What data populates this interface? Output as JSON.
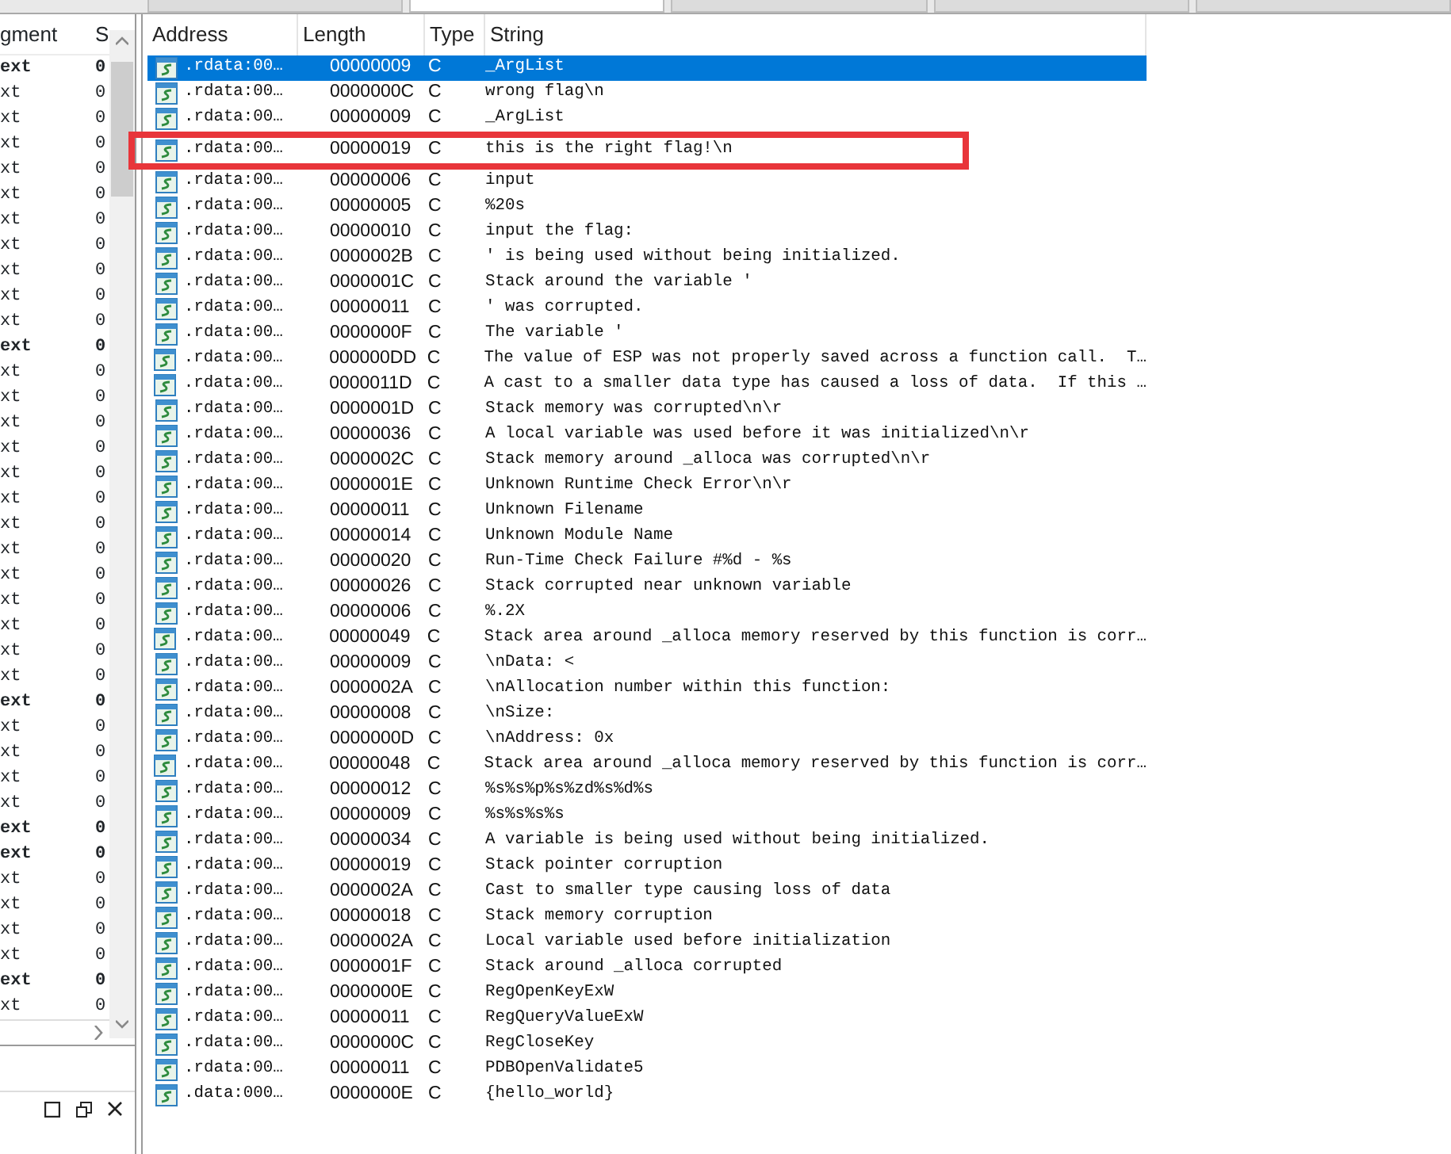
{
  "tabs": [
    {
      "selected": false
    },
    {
      "selected": true
    },
    {
      "selected": false
    },
    {
      "selected": false
    },
    {
      "selected": false
    }
  ],
  "segments_panel": {
    "columns": [
      "gment",
      "S"
    ],
    "rows": [
      {
        "segment": "ext",
        "start": "0",
        "bold": true
      },
      {
        "segment": "xt",
        "start": "0",
        "bold": false
      },
      {
        "segment": "xt",
        "start": "0",
        "bold": false
      },
      {
        "segment": "xt",
        "start": "0",
        "bold": false
      },
      {
        "segment": "xt",
        "start": "0",
        "bold": false
      },
      {
        "segment": "xt",
        "start": "0",
        "bold": false
      },
      {
        "segment": "xt",
        "start": "0",
        "bold": false
      },
      {
        "segment": "xt",
        "start": "0",
        "bold": false
      },
      {
        "segment": "xt",
        "start": "0",
        "bold": false
      },
      {
        "segment": "xt",
        "start": "0",
        "bold": false
      },
      {
        "segment": "xt",
        "start": "0",
        "bold": false
      },
      {
        "segment": "ext",
        "start": "0",
        "bold": true
      },
      {
        "segment": "xt",
        "start": "0",
        "bold": false
      },
      {
        "segment": "xt",
        "start": "0",
        "bold": false
      },
      {
        "segment": "xt",
        "start": "0",
        "bold": false
      },
      {
        "segment": "xt",
        "start": "0",
        "bold": false
      },
      {
        "segment": "xt",
        "start": "0",
        "bold": false
      },
      {
        "segment": "xt",
        "start": "0",
        "bold": false
      },
      {
        "segment": "xt",
        "start": "0",
        "bold": false
      },
      {
        "segment": "xt",
        "start": "0",
        "bold": false
      },
      {
        "segment": "xt",
        "start": "0",
        "bold": false
      },
      {
        "segment": "xt",
        "start": "0",
        "bold": false
      },
      {
        "segment": "xt",
        "start": "0",
        "bold": false
      },
      {
        "segment": "xt",
        "start": "0",
        "bold": false
      },
      {
        "segment": "xt",
        "start": "0",
        "bold": false
      },
      {
        "segment": "ext",
        "start": "0",
        "bold": true
      },
      {
        "segment": "xt",
        "start": "0",
        "bold": false
      },
      {
        "segment": "xt",
        "start": "0",
        "bold": false
      },
      {
        "segment": "xt",
        "start": "0",
        "bold": false
      },
      {
        "segment": "xt",
        "start": "0",
        "bold": false
      },
      {
        "segment": "ext",
        "start": "0",
        "bold": true
      },
      {
        "segment": "ext",
        "start": "0",
        "bold": true
      },
      {
        "segment": "xt",
        "start": "0",
        "bold": false
      },
      {
        "segment": "xt",
        "start": "0",
        "bold": false
      },
      {
        "segment": "xt",
        "start": "0",
        "bold": false
      },
      {
        "segment": "xt",
        "start": "0",
        "bold": false
      },
      {
        "segment": "ext",
        "start": "0",
        "bold": true
      },
      {
        "segment": "xt",
        "start": "0",
        "bold": false
      }
    ]
  },
  "strings_table": {
    "columns": [
      "Address",
      "Length",
      "Type",
      "String"
    ],
    "rows": [
      {
        "address": ".rdata:00…",
        "length": "00000009",
        "type": "C",
        "string": "_ArgList",
        "selected": true,
        "highlighted": false
      },
      {
        "address": ".rdata:00…",
        "length": "0000000C",
        "type": "C",
        "string": "wrong flag\\n",
        "selected": false,
        "highlighted": false
      },
      {
        "address": ".rdata:00…",
        "length": "00000009",
        "type": "C",
        "string": "_ArgList",
        "selected": false,
        "highlighted": false
      },
      {
        "address": ".rdata:00…",
        "length": "00000019",
        "type": "C",
        "string": "this is the right flag!\\n",
        "selected": false,
        "highlighted": true
      },
      {
        "address": ".rdata:00…",
        "length": "00000006",
        "type": "C",
        "string": "input",
        "selected": false,
        "highlighted": false
      },
      {
        "address": ".rdata:00…",
        "length": "00000005",
        "type": "C",
        "string": "%20s",
        "selected": false,
        "highlighted": false
      },
      {
        "address": ".rdata:00…",
        "length": "00000010",
        "type": "C",
        "string": "input the flag:",
        "selected": false,
        "highlighted": false
      },
      {
        "address": ".rdata:00…",
        "length": "0000002B",
        "type": "C",
        "string": "' is being used without being initialized.",
        "selected": false,
        "highlighted": false
      },
      {
        "address": ".rdata:00…",
        "length": "0000001C",
        "type": "C",
        "string": "Stack around the variable '",
        "selected": false,
        "highlighted": false
      },
      {
        "address": ".rdata:00…",
        "length": "00000011",
        "type": "C",
        "string": "' was corrupted.",
        "selected": false,
        "highlighted": false
      },
      {
        "address": ".rdata:00…",
        "length": "0000000F",
        "type": "C",
        "string": "The variable '",
        "selected": false,
        "highlighted": false
      },
      {
        "address": ".rdata:00…",
        "length": "000000DD",
        "type": "C",
        "string": "The value of ESP was not properly saved across a function call.  T…",
        "selected": false,
        "highlighted": false
      },
      {
        "address": ".rdata:00…",
        "length": "0000011D",
        "type": "C",
        "string": "A cast to a smaller data type has caused a loss of data.  If this …",
        "selected": false,
        "highlighted": false
      },
      {
        "address": ".rdata:00…",
        "length": "0000001D",
        "type": "C",
        "string": "Stack memory was corrupted\\n\\r",
        "selected": false,
        "highlighted": false
      },
      {
        "address": ".rdata:00…",
        "length": "00000036",
        "type": "C",
        "string": "A local variable was used before it was initialized\\n\\r",
        "selected": false,
        "highlighted": false
      },
      {
        "address": ".rdata:00…",
        "length": "0000002C",
        "type": "C",
        "string": "Stack memory around _alloca was corrupted\\n\\r",
        "selected": false,
        "highlighted": false
      },
      {
        "address": ".rdata:00…",
        "length": "0000001E",
        "type": "C",
        "string": "Unknown Runtime Check Error\\n\\r",
        "selected": false,
        "highlighted": false
      },
      {
        "address": ".rdata:00…",
        "length": "00000011",
        "type": "C",
        "string": "Unknown Filename",
        "selected": false,
        "highlighted": false
      },
      {
        "address": ".rdata:00…",
        "length": "00000014",
        "type": "C",
        "string": "Unknown Module Name",
        "selected": false,
        "highlighted": false
      },
      {
        "address": ".rdata:00…",
        "length": "00000020",
        "type": "C",
        "string": "Run-Time Check Failure #%d - %s",
        "selected": false,
        "highlighted": false
      },
      {
        "address": ".rdata:00…",
        "length": "00000026",
        "type": "C",
        "string": "Stack corrupted near unknown variable",
        "selected": false,
        "highlighted": false
      },
      {
        "address": ".rdata:00…",
        "length": "00000006",
        "type": "C",
        "string": "%.2X",
        "selected": false,
        "highlighted": false
      },
      {
        "address": ".rdata:00…",
        "length": "00000049",
        "type": "C",
        "string": "Stack area around _alloca memory reserved by this function is corr…",
        "selected": false,
        "highlighted": false
      },
      {
        "address": ".rdata:00…",
        "length": "00000009",
        "type": "C",
        "string": "\\nData: <",
        "selected": false,
        "highlighted": false
      },
      {
        "address": ".rdata:00…",
        "length": "0000002A",
        "type": "C",
        "string": "\\nAllocation number within this function:",
        "selected": false,
        "highlighted": false
      },
      {
        "address": ".rdata:00…",
        "length": "00000008",
        "type": "C",
        "string": "\\nSize:",
        "selected": false,
        "highlighted": false
      },
      {
        "address": ".rdata:00…",
        "length": "0000000D",
        "type": "C",
        "string": "\\nAddress: 0x",
        "selected": false,
        "highlighted": false
      },
      {
        "address": ".rdata:00…",
        "length": "00000048",
        "type": "C",
        "string": "Stack area around _alloca memory reserved by this function is corr…",
        "selected": false,
        "highlighted": false
      },
      {
        "address": ".rdata:00…",
        "length": "00000012",
        "type": "C",
        "string": "%s%s%p%s%zd%s%d%s",
        "selected": false,
        "highlighted": false
      },
      {
        "address": ".rdata:00…",
        "length": "00000009",
        "type": "C",
        "string": "%s%s%s%s",
        "selected": false,
        "highlighted": false
      },
      {
        "address": ".rdata:00…",
        "length": "00000034",
        "type": "C",
        "string": "A variable is being used without being initialized.",
        "selected": false,
        "highlighted": false
      },
      {
        "address": ".rdata:00…",
        "length": "00000019",
        "type": "C",
        "string": "Stack pointer corruption",
        "selected": false,
        "highlighted": false
      },
      {
        "address": ".rdata:00…",
        "length": "0000002A",
        "type": "C",
        "string": "Cast to smaller type causing loss of data",
        "selected": false,
        "highlighted": false
      },
      {
        "address": ".rdata:00…",
        "length": "00000018",
        "type": "C",
        "string": "Stack memory corruption",
        "selected": false,
        "highlighted": false
      },
      {
        "address": ".rdata:00…",
        "length": "0000002A",
        "type": "C",
        "string": "Local variable used before initialization",
        "selected": false,
        "highlighted": false
      },
      {
        "address": ".rdata:00…",
        "length": "0000001F",
        "type": "C",
        "string": "Stack around _alloca corrupted",
        "selected": false,
        "highlighted": false
      },
      {
        "address": ".rdata:00…",
        "length": "0000000E",
        "type": "C",
        "string": "RegOpenKeyExW",
        "selected": false,
        "highlighted": false
      },
      {
        "address": ".rdata:00…",
        "length": "00000011",
        "type": "C",
        "string": "RegQueryValueExW",
        "selected": false,
        "highlighted": false
      },
      {
        "address": ".rdata:00…",
        "length": "0000000C",
        "type": "C",
        "string": "RegCloseKey",
        "selected": false,
        "highlighted": false
      },
      {
        "address": ".rdata:00…",
        "length": "00000011",
        "type": "C",
        "string": "PDBOpenValidate5",
        "selected": false,
        "highlighted": false
      },
      {
        "address": ".data:000…",
        "length": "0000000E",
        "type": "C",
        "string": "{hello_world}",
        "selected": false,
        "highlighted": false
      }
    ]
  }
}
